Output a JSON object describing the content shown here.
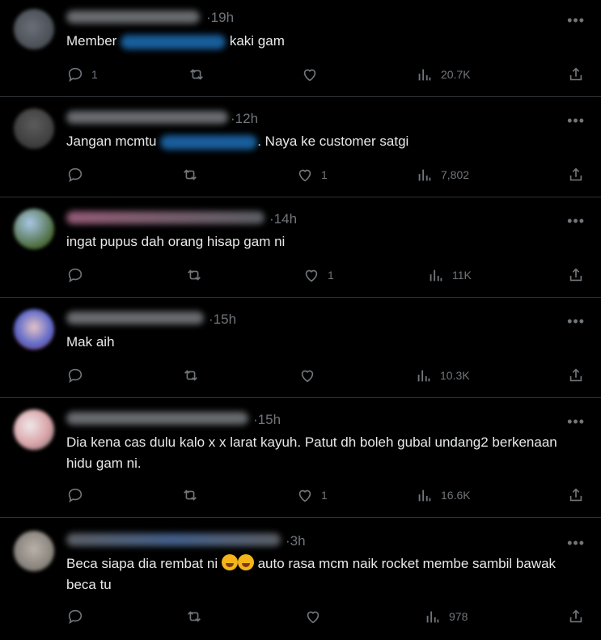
{
  "replies": [
    {
      "time": "19h",
      "text_before": "Member",
      "text_after": "kaki gam",
      "reply_count": "1",
      "repost_count": "",
      "like_count": "",
      "view_count": "20.7K"
    },
    {
      "time": "12h",
      "text_before": "Jangan mcmtu",
      "text_after": ". Naya ke customer satgi",
      "reply_count": "",
      "repost_count": "",
      "like_count": "1",
      "view_count": "7,802"
    },
    {
      "time": "14h",
      "text": "ingat pupus dah orang hisap gam ni",
      "reply_count": "",
      "repost_count": "",
      "like_count": "1",
      "view_count": "11K"
    },
    {
      "time": "15h",
      "text": "Mak aih",
      "reply_count": "",
      "repost_count": "",
      "like_count": "",
      "view_count": "10.3K"
    },
    {
      "time": "15h",
      "text": "Dia kena cas dulu kalo x x larat kayuh. Patut dh boleh gubal undang2 berkenaan hidu gam ni.",
      "reply_count": "",
      "repost_count": "",
      "like_count": "1",
      "view_count": "16.6K"
    },
    {
      "time": "3h",
      "text_before": "Beca siapa dia rembat ni",
      "text_after": "auto rasa mcm naik rocket membe sambil bawak beca tu",
      "reply_count": "",
      "repost_count": "",
      "like_count": "",
      "view_count": "978"
    }
  ],
  "icons": {
    "reply": "reply-icon",
    "repost": "repost-icon",
    "like": "heart-icon",
    "views": "views-icon",
    "share": "share-icon",
    "more": "more-icon",
    "emoji": "rolling-laughing-emoji-icon"
  },
  "colors": {
    "background": "#000000",
    "text": "#e7e9ea",
    "muted": "#71767b",
    "divider": "#2f3336"
  }
}
